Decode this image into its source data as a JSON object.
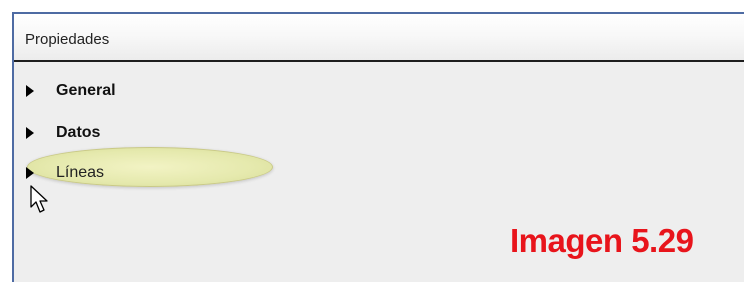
{
  "panel": {
    "title": "Propiedades"
  },
  "sections": [
    {
      "label": "General",
      "expanded": false
    },
    {
      "label": "Datos",
      "expanded": false
    },
    {
      "label": "Líneas",
      "expanded": false,
      "highlighted": true
    }
  ],
  "caption": "Imagen 5.29",
  "colors": {
    "border": "#4e6ba3",
    "highlight": "#e5e9ad",
    "caption": "#e8141b"
  },
  "icons": {
    "expander": "triangle-right",
    "pointer": "mouse-cursor-arrow"
  }
}
